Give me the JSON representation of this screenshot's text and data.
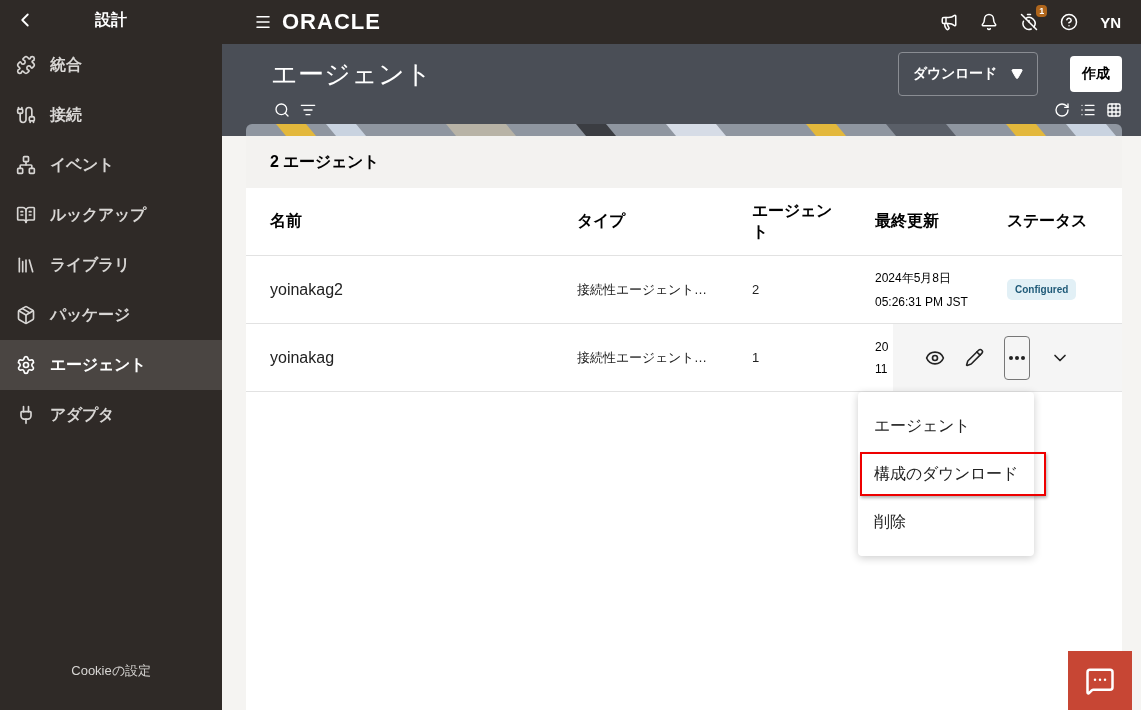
{
  "sidebar": {
    "back": "設計",
    "items": [
      {
        "label": "統合",
        "selected": false
      },
      {
        "label": "接続",
        "selected": false
      },
      {
        "label": "イベント",
        "selected": false
      },
      {
        "label": "ルックアップ",
        "selected": false
      },
      {
        "label": "ライブラリ",
        "selected": false
      },
      {
        "label": "パッケージ",
        "selected": false
      },
      {
        "label": "エージェント",
        "selected": true
      },
      {
        "label": "アダプタ",
        "selected": false
      }
    ],
    "footer": "Cookieの設定"
  },
  "topbar": {
    "logo": "ORACLE",
    "badge": "1",
    "user": "YN"
  },
  "header": {
    "title": "エージェント",
    "download": "ダウンロード",
    "create": "作成"
  },
  "count": "2 エージェント",
  "table": {
    "columns": [
      "名前",
      "タイプ",
      "エージェント",
      "最終更新",
      "ステータス"
    ],
    "rows": [
      {
        "name": "yoinakag2",
        "type": "接続性エージェント…",
        "agents": "2",
        "updated": [
          "2024年5月8日",
          "05:26:31 PM JST"
        ],
        "status": "Configured",
        "hovered": false
      },
      {
        "name": "yoinakag",
        "type": "接続性エージェント…",
        "agents": "1",
        "updated": [
          "20",
          "11"
        ],
        "hovered": true
      }
    ]
  },
  "menu": {
    "items": [
      {
        "label": "エージェント",
        "highlighted": false
      },
      {
        "label": "構成のダウンロード",
        "highlighted": true
      },
      {
        "label": "削除",
        "highlighted": false
      }
    ]
  }
}
